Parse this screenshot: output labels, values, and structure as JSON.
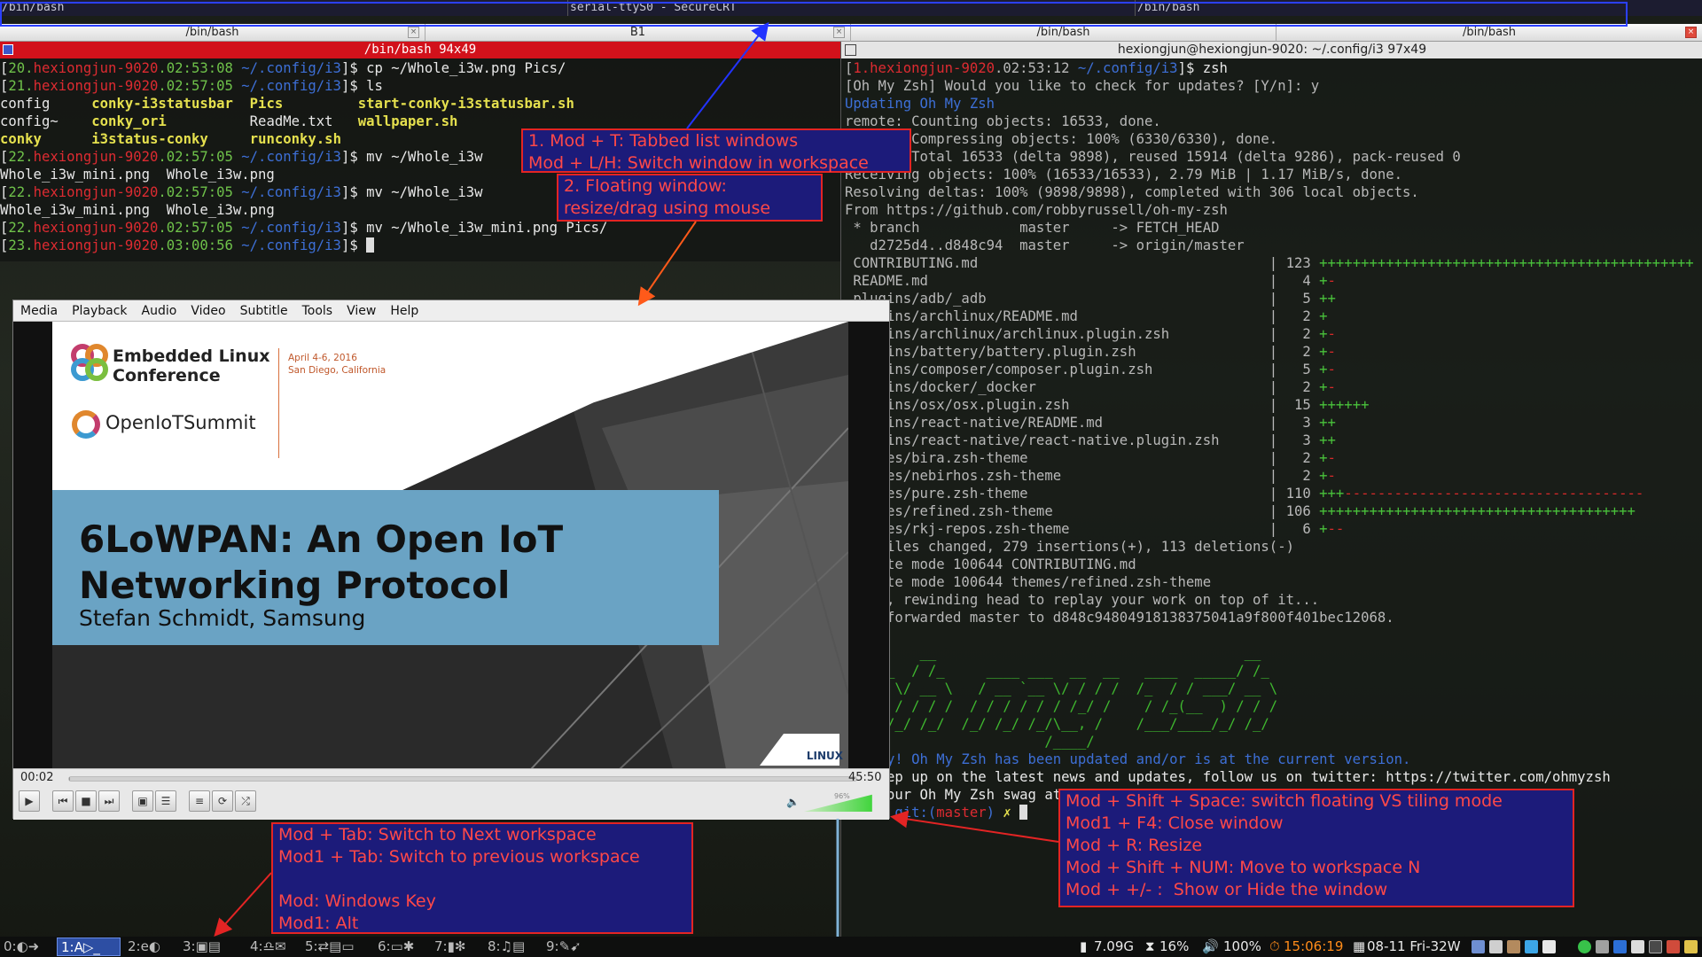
{
  "top_tabs": [
    {
      "title": "/bin/bash"
    },
    {
      "title": "serial-ttyS0 - SecureCRT"
    },
    {
      "title": "/bin/bash"
    }
  ],
  "sub_tabs": [
    {
      "title": "/bin/bash"
    },
    {
      "title": "B1"
    },
    {
      "title": "/bin/bash"
    },
    {
      "title": "/bin/bash"
    }
  ],
  "left_terminal": {
    "title": "/bin/bash 94x49",
    "lines": [
      [
        {
          "t": "[",
          "c": "w"
        },
        {
          "t": "20.",
          "c": "g"
        },
        {
          "t": "hexiongjun-9020",
          "c": "r"
        },
        {
          "t": ".02:53:08 ",
          "c": "g"
        },
        {
          "t": "~/.config/i3",
          "c": "b"
        },
        {
          "t": "]$ cp ~/Whole_i3w.png Pics/",
          "c": "w"
        }
      ],
      [
        {
          "t": "[",
          "c": "w"
        },
        {
          "t": "21.",
          "c": "g"
        },
        {
          "t": "hexiongjun-9020",
          "c": "r"
        },
        {
          "t": ".02:57:05 ",
          "c": "g"
        },
        {
          "t": "~/.config/i3",
          "c": "b"
        },
        {
          "t": "]$ ls",
          "c": "w"
        }
      ],
      [
        {
          "t": "config     ",
          "c": "w"
        },
        {
          "t": "conky-i3statusbar",
          "c": "y"
        },
        {
          "t": "  ",
          "c": "w"
        },
        {
          "t": "Pics",
          "c": "y"
        },
        {
          "t": "         ",
          "c": "w"
        },
        {
          "t": "start-conky-i3statusbar.sh",
          "c": "y"
        }
      ],
      [
        {
          "t": "config~    ",
          "c": "w"
        },
        {
          "t": "conky_ori",
          "c": "y"
        },
        {
          "t": "          ReadMe.txt   ",
          "c": "w"
        },
        {
          "t": "wallpaper.sh",
          "c": "y"
        }
      ],
      [
        {
          "t": "conky",
          "c": "y"
        },
        {
          "t": "      ",
          "c": "w"
        },
        {
          "t": "i3status-conky",
          "c": "y"
        },
        {
          "t": "     ",
          "c": "w"
        },
        {
          "t": "runconky.sh",
          "c": "y"
        }
      ],
      [
        {
          "t": "[",
          "c": "w"
        },
        {
          "t": "22.",
          "c": "g"
        },
        {
          "t": "hexiongjun-9020",
          "c": "r"
        },
        {
          "t": ".02:57:05 ",
          "c": "g"
        },
        {
          "t": "~/.config/i3",
          "c": "b"
        },
        {
          "t": "]$ mv ~/Whole_i3w",
          "c": "w"
        }
      ],
      [
        {
          "t": "Whole_i3w_mini.png  Whole_i3w.png",
          "c": "w"
        }
      ],
      [
        {
          "t": "[",
          "c": "w"
        },
        {
          "t": "22.",
          "c": "g"
        },
        {
          "t": "hexiongjun-9020",
          "c": "r"
        },
        {
          "t": ".02:57:05 ",
          "c": "g"
        },
        {
          "t": "~/.config/i3",
          "c": "b"
        },
        {
          "t": "]$ mv ~/Whole_i3w",
          "c": "w"
        }
      ],
      [
        {
          "t": "Whole_i3w_mini.png  Whole_i3w.png",
          "c": "w"
        }
      ],
      [
        {
          "t": "[",
          "c": "w"
        },
        {
          "t": "22.",
          "c": "g"
        },
        {
          "t": "hexiongjun-9020",
          "c": "r"
        },
        {
          "t": ".02:57:05 ",
          "c": "g"
        },
        {
          "t": "~/.config/i3",
          "c": "b"
        },
        {
          "t": "]$ mv ~/Whole_i3w_mini.png Pics/",
          "c": "w"
        }
      ],
      [
        {
          "t": "[",
          "c": "w"
        },
        {
          "t": "23.",
          "c": "g"
        },
        {
          "t": "hexiongjun-9020",
          "c": "r"
        },
        {
          "t": ".03:00:56 ",
          "c": "g"
        },
        {
          "t": "~/.config/i3",
          "c": "b"
        },
        {
          "t": "]$ ",
          "c": "w"
        }
      ]
    ]
  },
  "right_terminal": {
    "title": "hexiongjun@hexiongjun-9020: ~/.config/i3 97x49",
    "lines": [
      [
        {
          "t": "[",
          "c": "d"
        },
        {
          "t": "1.hexiongjun-9020",
          "c": "r"
        },
        {
          "t": ".02:53:12 ",
          "c": "d"
        },
        {
          "t": "~/.config/i3",
          "c": "b"
        },
        {
          "t": "]$ zsh",
          "c": "w"
        }
      ],
      [
        {
          "t": "[Oh My Zsh] Would you like to check for updates? [Y/n]: y",
          "c": "d"
        }
      ],
      [
        {
          "t": "Updating Oh My Zsh",
          "c": "b"
        }
      ],
      [
        {
          "t": "remote: Counting objects: 16533, done.",
          "c": "d"
        }
      ],
      [
        {
          "t": "remote: Compressing objects: 100% (6330/6330), done.",
          "c": "d"
        }
      ],
      [
        {
          "t": "remote: Total 16533 (delta 9898), reused 15914 (delta 9286), pack-reused 0",
          "c": "d"
        }
      ],
      [
        {
          "t": "Receiving objects: 100% (16533/16533), 2.79 MiB | 1.17 MiB/s, done.",
          "c": "d"
        }
      ],
      [
        {
          "t": "Resolving deltas: 100% (9898/9898), completed with 306 local objects.",
          "c": "d"
        }
      ],
      [
        {
          "t": "From https://github.com/robbyrussell/oh-my-zsh",
          "c": "d"
        }
      ],
      [
        {
          "t": " * branch            master     -> FETCH_HEAD",
          "c": "d"
        }
      ],
      [
        {
          "t": "   d2725d4..d848c94  master     -> origin/master",
          "c": "d"
        }
      ],
      [
        {
          "t": " CONTRIBUTING.md                                   | 123 ",
          "c": "d"
        },
        {
          "t": "+++++++++++++++++++++++++++++++++++++++++++++",
          "c": "plus"
        }
      ],
      [
        {
          "t": " README.md                                         |   4 ",
          "c": "d"
        },
        {
          "t": "+",
          "c": "plus"
        },
        {
          "t": "-",
          "c": "minus"
        }
      ],
      [
        {
          "t": " plugins/adb/_adb                                  |   5 ",
          "c": "d"
        },
        {
          "t": "++",
          "c": "plus"
        }
      ],
      [
        {
          "t": " plugins/archlinux/README.md                       |   2 ",
          "c": "d"
        },
        {
          "t": "+",
          "c": "plus"
        }
      ],
      [
        {
          "t": " plugins/archlinux/archlinux.plugin.zsh            |   2 ",
          "c": "d"
        },
        {
          "t": "+",
          "c": "plus"
        },
        {
          "t": "-",
          "c": "minus"
        }
      ],
      [
        {
          "t": " plugins/battery/battery.plugin.zsh                |   2 ",
          "c": "d"
        },
        {
          "t": "+",
          "c": "plus"
        },
        {
          "t": "-",
          "c": "minus"
        }
      ],
      [
        {
          "t": " plugins/composer/composer.plugin.zsh              |   5 ",
          "c": "d"
        },
        {
          "t": "+",
          "c": "plus"
        },
        {
          "t": "-",
          "c": "minus"
        }
      ],
      [
        {
          "t": " plugins/docker/_docker                            |   2 ",
          "c": "d"
        },
        {
          "t": "+",
          "c": "plus"
        },
        {
          "t": "-",
          "c": "minus"
        }
      ],
      [
        {
          "t": " plugins/osx/osx.plugin.zsh                        |  15 ",
          "c": "d"
        },
        {
          "t": "++++++",
          "c": "plus"
        }
      ],
      [
        {
          "t": " plugins/react-native/README.md                    |   3 ",
          "c": "d"
        },
        {
          "t": "++",
          "c": "plus"
        }
      ],
      [
        {
          "t": " plugins/react-native/react-native.plugin.zsh      |   3 ",
          "c": "d"
        },
        {
          "t": "++",
          "c": "plus"
        }
      ],
      [
        {
          "t": " themes/bira.zsh-theme                             |   2 ",
          "c": "d"
        },
        {
          "t": "+",
          "c": "plus"
        },
        {
          "t": "-",
          "c": "minus"
        }
      ],
      [
        {
          "t": " themes/nebirhos.zsh-theme                         |   2 ",
          "c": "d"
        },
        {
          "t": "+",
          "c": "plus"
        },
        {
          "t": "-",
          "c": "minus"
        }
      ],
      [
        {
          "t": " themes/pure.zsh-theme                             | 110 ",
          "c": "d"
        },
        {
          "t": "+++",
          "c": "plus"
        },
        {
          "t": "------------------------------------",
          "c": "minus"
        }
      ],
      [
        {
          "t": " themes/refined.zsh-theme                          | 106 ",
          "c": "d"
        },
        {
          "t": "++++++++++++++++++++++++++++++++++++++",
          "c": "plus"
        }
      ],
      [
        {
          "t": " themes/rkj-repos.zsh-theme                        |   6 ",
          "c": "d"
        },
        {
          "t": "+",
          "c": "plus"
        },
        {
          "t": "--",
          "c": "minus"
        }
      ],
      [
        {
          "t": " 16 files changed, 279 insertions(+), 113 deletions(-)",
          "c": "d"
        }
      ],
      [
        {
          "t": " create mode 100644 CONTRIBUTING.md",
          "c": "d"
        }
      ],
      [
        {
          "t": " create mode 100644 themes/refined.zsh-theme",
          "c": "d"
        }
      ],
      [
        {
          "t": "First, rewinding head to replay your work on top of it...",
          "c": "d"
        }
      ],
      [
        {
          "t": "Fast-forwarded master to d848c94804918138375041a9f800f401bec12068.",
          "c": "d"
        }
      ],
      [
        {
          "t": " ",
          "c": "d"
        }
      ],
      [
        {
          "t": "         __                                     __",
          "c": "ascii"
        }
      ],
      [
        {
          "t": "  ____  / /_     ____ ___  __  __   ____  _____/ /_",
          "c": "ascii"
        }
      ],
      [
        {
          "t": " / __ \\/ __ \\   / __ `__ \\/ / / /  /_  / / ___/ __ \\",
          "c": "ascii"
        }
      ],
      [
        {
          "t": "/ /_/ / / / /  / / / / / / /_/ /    / /_(__  ) / / /",
          "c": "ascii"
        }
      ],
      [
        {
          "t": "\\____/_/ /_/  /_/ /_/ /_/\\__, /    /___/____/_/ /_/",
          "c": "ascii"
        }
      ],
      [
        {
          "t": "                        /____/",
          "c": "ascii"
        }
      ],
      [
        {
          "t": "Hooray! Oh My Zsh has been updated and/or is at the current version.",
          "c": "b"
        }
      ],
      [
        {
          "t": "To keep up on the latest news and updates, follow us on twitter: https://twitter.com/ohmyzsh",
          "c": "w"
        }
      ],
      [
        {
          "t": "Get your Oh My Zsh swag at:  http://shop.planetargon.com/",
          "c": "w"
        }
      ],
      [
        {
          "t": "➜  i3 ",
          "c": "g"
        },
        {
          "t": "git:(",
          "c": "b"
        },
        {
          "t": "master",
          "c": "r"
        },
        {
          "t": ") ",
          "c": "b"
        },
        {
          "t": "✗ ",
          "c": "y"
        }
      ]
    ]
  },
  "vlc": {
    "menu": [
      "Media",
      "Playback",
      "Audio",
      "Video",
      "Subtitle",
      "Tools",
      "View",
      "Help"
    ],
    "slide": {
      "conference": "Embedded Linux\nConference",
      "date": "April 4-6, 2016\nSan Diego, California",
      "summit": "OpenIoTSummit",
      "title": "6LoWPAN: An Open IoT Networking Protocol",
      "subtitle": "Stefan Schmidt, Samsung",
      "foundation": "LINUX"
    },
    "elapsed": "00:02",
    "duration": "45:50",
    "progress": 0.001,
    "volume_label": "96%",
    "volume": 0.96
  },
  "annotations": {
    "tabbed": "1. Mod + T: Tabbed list windows\nMod + L/H: Switch window in workspace",
    "floating": "2. Floating window:\nresize/drag using mouse",
    "workspace": "Mod + Tab: Switch to Next workspace\nMod1 + Tab: Switch to previous workspace\n\nMod: Windows Key\nMod1: Alt",
    "modes": "Mod + Shift + Space: switch floating VS tiling mode\nMod1 + F4: Close window\nMod + R: Resize\nMod + Shift + NUM: Move to workspace N\nMod + +/- :  Show or Hide the window"
  },
  "bar": {
    "workspaces": [
      "0:◐➜",
      "1:A▷_",
      "2:e◐",
      "3:▣▤",
      "4:♎✉",
      "5:⇄▤▭",
      "6:▭✱",
      "7:▮✻",
      "8:♫▤",
      "9:✎➹"
    ],
    "active_workspace": "1:A▷_",
    "disk": "7.09G",
    "cpu": "16%",
    "volume": "100%",
    "time": "15:06:19",
    "date": "08-11 Fri-32W",
    "colors": {
      "time": "#ff8c1a",
      "active_ws": "#2d4ea3"
    }
  }
}
